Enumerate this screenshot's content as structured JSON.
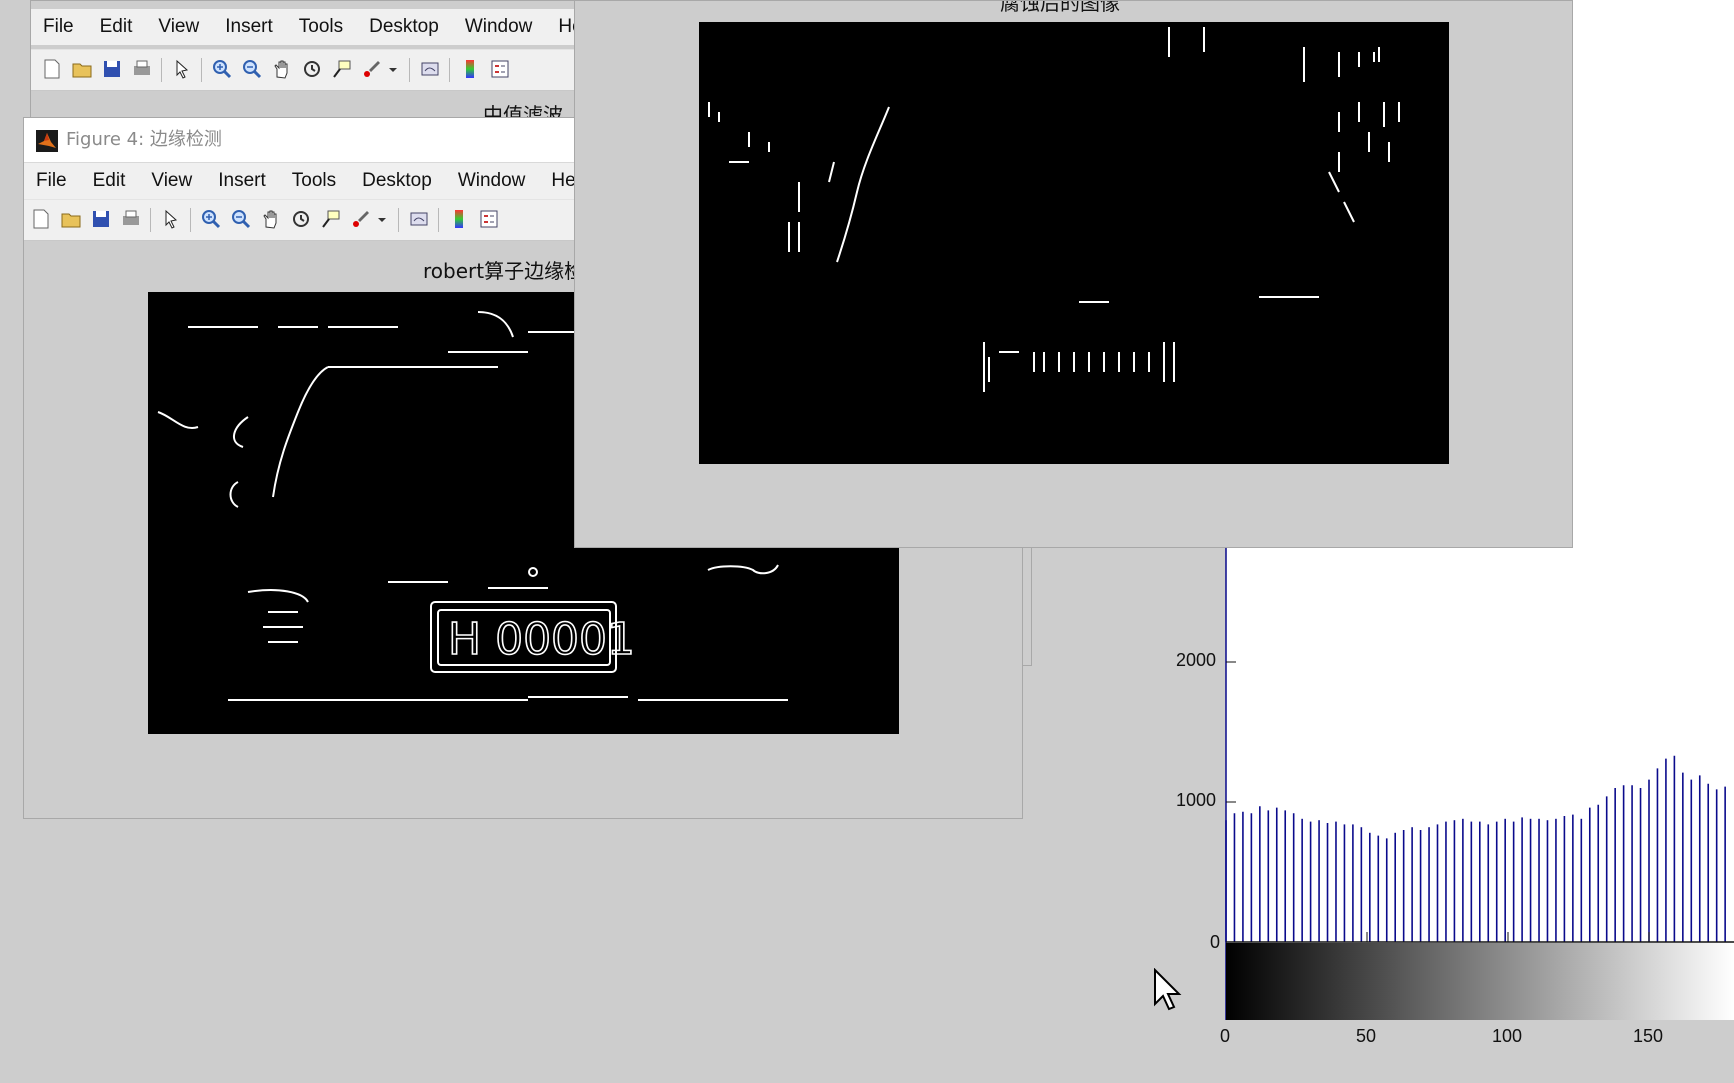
{
  "menus": [
    "File",
    "Edit",
    "View",
    "Insert",
    "Tools",
    "Desktop",
    "Window",
    "He"
  ],
  "back_window": {
    "title_partial": "中值滤波"
  },
  "figure4": {
    "title": "Figure 4: 边缘检测",
    "axes_title": "robert算子边缘检"
  },
  "front_window": {
    "axes_title": "腐蚀后的图像"
  },
  "plate_text": "H 00001",
  "histogram": {
    "y_ticks": [
      "2000",
      "1000",
      "0"
    ],
    "x_ticks": [
      "0",
      "50",
      "100",
      "150"
    ],
    "bar_color": "#0a0a8c",
    "chart_data": {
      "type": "bar",
      "x": [
        0,
        3,
        6,
        9,
        12,
        15,
        18,
        21,
        24,
        27,
        30,
        33,
        36,
        39,
        42,
        45,
        48,
        51,
        54,
        57,
        60,
        63,
        66,
        69,
        72,
        75,
        78,
        81,
        84,
        87,
        90,
        93,
        96,
        99,
        102,
        105,
        108,
        111,
        114,
        117,
        120,
        123,
        126,
        129,
        132,
        135,
        138,
        141,
        144,
        147,
        150,
        153,
        156,
        159,
        162,
        165,
        168,
        171,
        174,
        177
      ],
      "values": [
        870,
        920,
        930,
        920,
        970,
        940,
        960,
        940,
        920,
        880,
        860,
        870,
        850,
        860,
        840,
        840,
        820,
        780,
        760,
        740,
        780,
        800,
        820,
        800,
        820,
        840,
        860,
        870,
        880,
        860,
        860,
        840,
        860,
        880,
        860,
        890,
        880,
        880,
        870,
        880,
        900,
        910,
        880,
        960,
        980,
        1040,
        1100,
        1120,
        1120,
        1100,
        1160,
        1240,
        1310,
        1330,
        1210,
        1160,
        1190,
        1130,
        1090,
        1110
      ],
      "xlim": [
        0,
        180
      ],
      "ylim": [
        0,
        2000
      ]
    }
  }
}
